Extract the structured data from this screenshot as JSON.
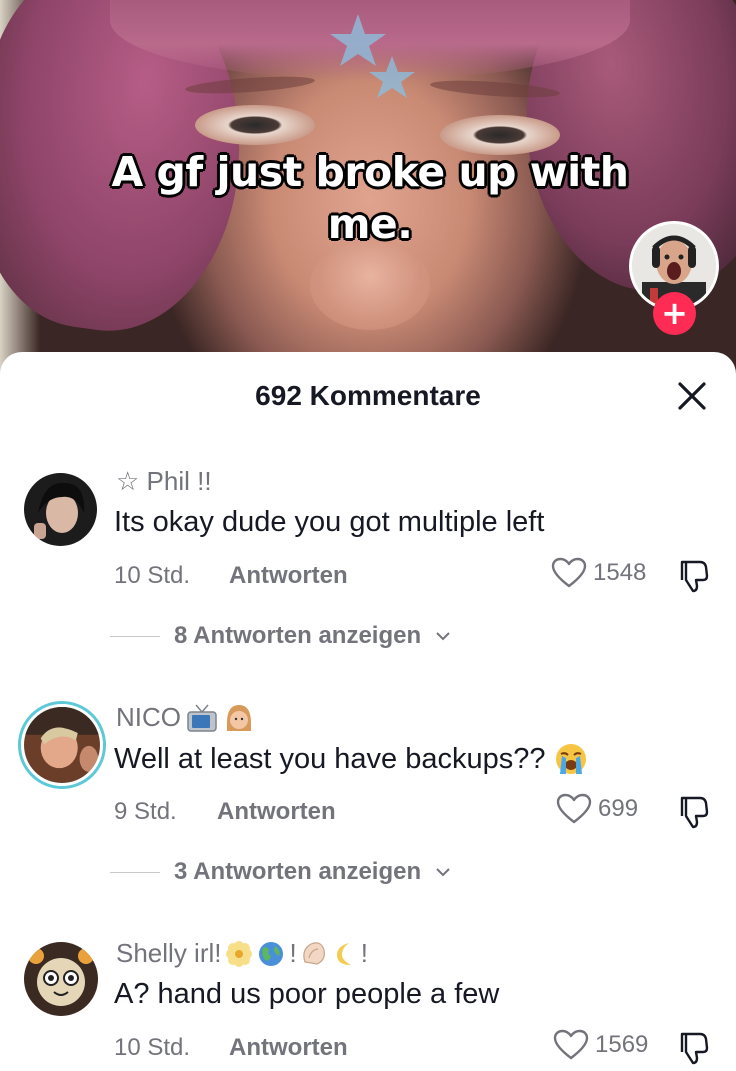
{
  "video": {
    "caption_line1": "A gf just broke up with",
    "caption_line2": "me.",
    "follow_icon": "plus-icon",
    "follow_label": "+",
    "accent_color": "#fe2c55"
  },
  "comments_sheet": {
    "title": "692 Kommentare",
    "close_icon": "close-icon"
  },
  "comments": [
    {
      "username": "☆ Phil !!",
      "text": "Its okay dude you got multiple left",
      "time": "10 Std.",
      "reply_label": "Antworten",
      "likes": "1548",
      "view_replies": "8 Antworten anzeigen"
    },
    {
      "username": "NICO",
      "username_emojis": [
        "television-emoji",
        "girl-emoji"
      ],
      "text": "Well at least you have backups??",
      "text_emoji": "crying-face-emoji",
      "time": "9 Std.",
      "reply_label": "Antworten",
      "likes": "699",
      "view_replies": "3 Antworten anzeigen"
    },
    {
      "username": "Shelly irl!",
      "username_emojis": [
        "blossom-emoji",
        "globe-emoji",
        "exclamation",
        "shell-emoji",
        "moon-emoji",
        "exclamation"
      ],
      "text": "A? hand us poor people a few",
      "time": "10 Std.",
      "reply_label": "Antworten",
      "likes": "1569"
    }
  ]
}
